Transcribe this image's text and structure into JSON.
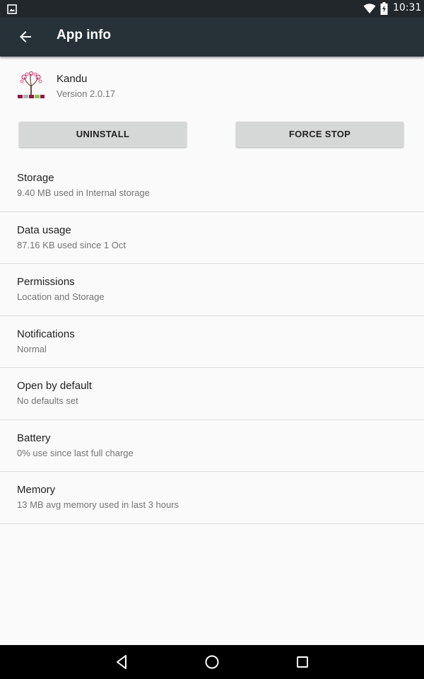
{
  "status_bar": {
    "time": "10:31",
    "icons": [
      "image-notification-icon",
      "wifi-icon",
      "battery-charging-icon"
    ]
  },
  "app_bar": {
    "title": "App info",
    "back_icon": "arrow-back-icon"
  },
  "app": {
    "name": "Kandu",
    "version": "Version 2.0.17",
    "icon": "kandu-tree-logo"
  },
  "buttons": {
    "uninstall": "UNINSTALL",
    "force_stop": "FORCE STOP"
  },
  "items": [
    {
      "title": "Storage",
      "summary": "9.40 MB used in Internal storage"
    },
    {
      "title": "Data usage",
      "summary": "87.16 KB used since 1 Oct"
    },
    {
      "title": "Permissions",
      "summary": "Location and Storage"
    },
    {
      "title": "Notifications",
      "summary": "Normal"
    },
    {
      "title": "Open by default",
      "summary": "No defaults set"
    },
    {
      "title": "Battery",
      "summary": "0% use since last full charge"
    },
    {
      "title": "Memory",
      "summary": "13 MB avg memory used in last 3 hours"
    }
  ],
  "nav_bar": {
    "icons": [
      "nav-back-icon",
      "nav-home-icon",
      "nav-recents-icon"
    ]
  },
  "colors": {
    "status_bar": "#21272b",
    "app_bar": "#263238",
    "background": "#fafafa",
    "button": "#d6d7d7"
  }
}
